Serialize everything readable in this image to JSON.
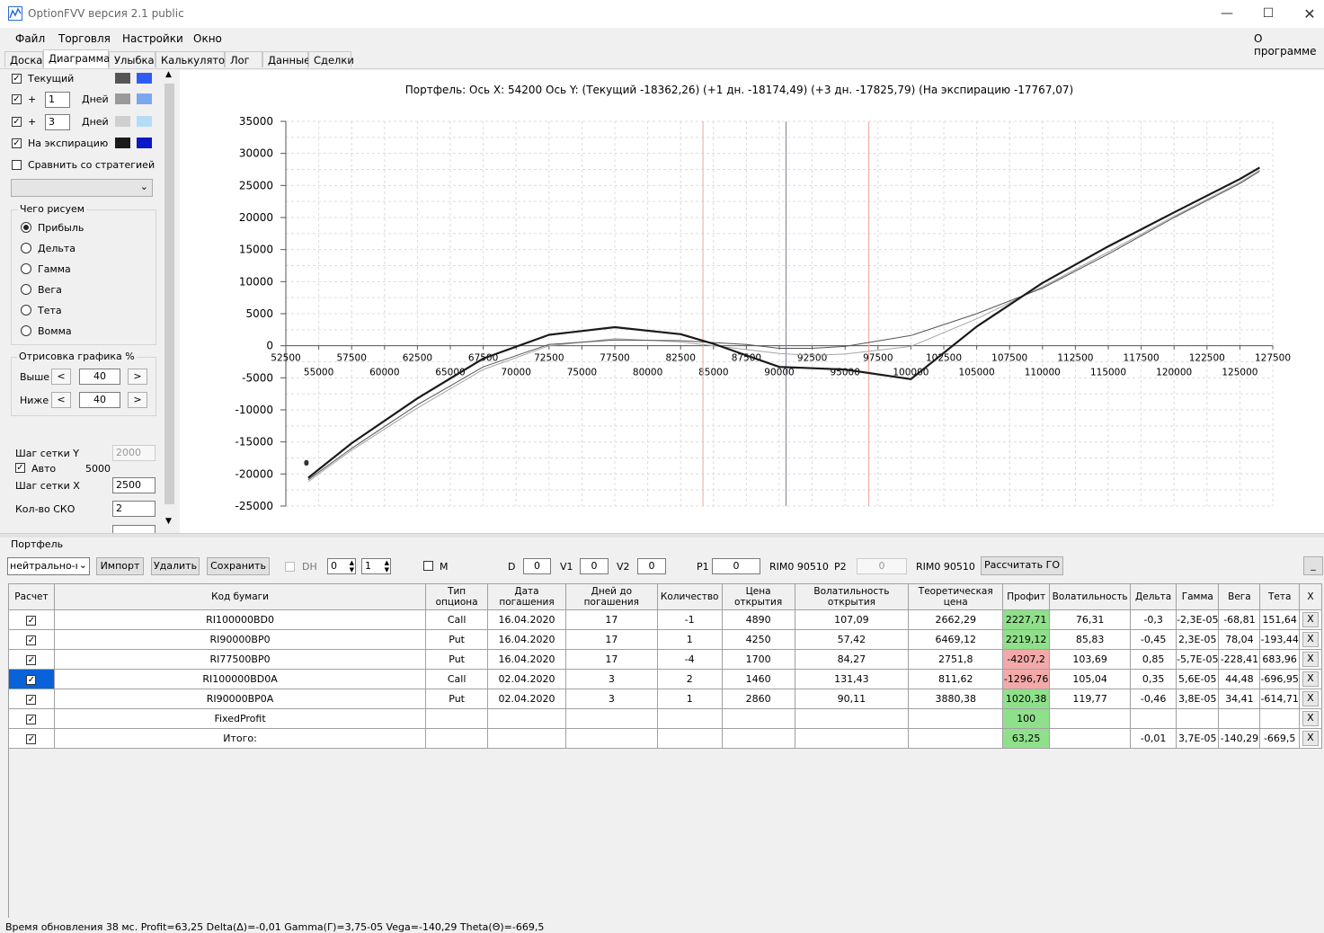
{
  "window": {
    "title": "OptionFVV версия 2.1 public"
  },
  "menu": {
    "items": [
      "Файл",
      "Торговля",
      "Настройки",
      "Окно"
    ],
    "about": "О программе"
  },
  "tabs": [
    "Доска",
    "Диаграмма",
    "Улыбка",
    "Калькулятор",
    "Лог",
    "Данные",
    "Сделки"
  ],
  "left": {
    "current_label": "Текущий",
    "plus": "+",
    "days_label": "Дней",
    "days1": "1",
    "days2": "3",
    "expiry_label": "На экспирацию",
    "compare_label": "Сравнить со стратегией",
    "what_title": "Чего рисуем",
    "radios": [
      "Прибыль",
      "Дельта",
      "Гамма",
      "Вега",
      "Тета",
      "Вомма"
    ],
    "draw_title": "Отрисовка графика %",
    "above_label": "Выше",
    "below_label": "Ниже",
    "above_val": "40",
    "below_val": "40",
    "lt": "<",
    "gt": ">",
    "gridy_label": "Шаг сетки Y",
    "gridy_val": "2000",
    "auto_label": "Авто",
    "auto_val": "5000",
    "gridx_label": "Шаг сетки X",
    "gridx_val": "2500",
    "sko_label": "Кол-во СКО",
    "sko_val": "2",
    "colors": {
      "current": [
        "#555555",
        "#2e5cf5"
      ],
      "d1": [
        "#9a9a9a",
        "#7aa7f0"
      ],
      "d3": [
        "#cfcfcf",
        "#b5dcf7"
      ],
      "expiry": [
        "#1a1a1a",
        "#0a18c8"
      ]
    }
  },
  "chart_data": {
    "type": "line",
    "title": "Портфель: Ось X: 54200 Ось Y: (Текущий -18362,26) (+1 дн. -18174,49) (+3 дн. -17825,79) (На экспирацию -17767,07)",
    "xlim": [
      52500,
      127500
    ],
    "ylim": [
      -25000,
      35000
    ],
    "x_ticks_top": [
      52500,
      57500,
      62500,
      67500,
      72500,
      77500,
      82500,
      87500,
      92500,
      97500,
      102500,
      107500,
      112500,
      117500,
      122500,
      127500
    ],
    "x_ticks_bottom": [
      55000,
      60000,
      65000,
      70000,
      75000,
      80000,
      85000,
      90000,
      95000,
      100000,
      105000,
      110000,
      115000,
      120000,
      125000
    ],
    "y_ticks": [
      35000,
      30000,
      25000,
      20000,
      15000,
      10000,
      5000,
      0,
      -5000,
      -10000,
      -15000,
      -20000,
      -25000
    ],
    "vlines": [
      {
        "x": 84200,
        "color": "#f2a6a6"
      },
      {
        "x": 90510,
        "color": "#7a7d99"
      },
      {
        "x": 96800,
        "color": "#f2a6a6"
      }
    ],
    "series": [
      {
        "color": "#1a1a1a",
        "width": 2.2,
        "x": [
          54200,
          57500,
          62500,
          67500,
          72500,
          77500,
          82500,
          85000,
          87500,
          90000,
          95000,
          100000,
          105000,
          110000,
          115000,
          120000,
          125000,
          126500
        ],
        "y": [
          -20600,
          -15200,
          -8200,
          -2000,
          1700,
          2900,
          1800,
          300,
          -1500,
          -3300,
          -3700,
          -5200,
          3000,
          9800,
          15500,
          20800,
          26000,
          27800
        ]
      },
      {
        "color": "#555555",
        "width": 1,
        "x": [
          54200,
          57500,
          62500,
          67500,
          72500,
          77500,
          82500,
          87500,
          90000,
          92500,
          95000,
          100000,
          105000,
          110000,
          115000,
          120000,
          125000,
          126500
        ],
        "y": [
          -20900,
          -16000,
          -9200,
          -3300,
          200,
          900,
          800,
          200,
          -400,
          -400,
          -100,
          1600,
          5000,
          9000,
          14300,
          20000,
          25300,
          27200
        ]
      },
      {
        "color": "#a6a6a6",
        "width": 1,
        "x": [
          54200,
          57500,
          62500,
          67500,
          72500,
          77500,
          82500,
          87500,
          90000,
          92500,
          95000,
          100000,
          105000,
          110000,
          115000,
          120000,
          125000,
          126500
        ],
        "y": [
          -21200,
          -16300,
          -9700,
          -3700,
          0,
          1100,
          600,
          -600,
          -1200,
          -1500,
          -1300,
          -100,
          4200,
          9200,
          14600,
          20200,
          25500,
          27400
        ]
      }
    ],
    "markers": [
      {
        "x": 54200,
        "y": -18362
      },
      {
        "x": 54200,
        "y": -18174
      }
    ]
  },
  "portfolio": {
    "title": "Портфель",
    "strategy_select": "нейтрально-н",
    "import_btn": "Импорт",
    "delete_btn": "Удалить",
    "save_btn": "Сохранить",
    "dh_label": "DH",
    "spin1": "0",
    "spin2": "1",
    "m_label": "M",
    "d_label": "D",
    "d_val": "0",
    "v1_label": "V1",
    "v1_val": "0",
    "v2_label": "V2",
    "v2_val": "0",
    "p1_label": "P1",
    "p1_val": "0",
    "rim1": "RIM0 90510",
    "p2_label": "P2",
    "p2_val": "0",
    "rim2": "RIM0 90510",
    "calc_btn": "Рассчитать ГО",
    "min_btn": "_"
  },
  "table": {
    "headers": [
      "Расчет",
      "Код бумаги",
      "Тип опциона",
      "Дата погашения",
      "Дней до погашения",
      "Количество",
      "Цена открытия",
      "Волатильность открытия",
      "Теоретическая цена",
      "Профит",
      "Волатильность",
      "Дельта",
      "Гамма",
      "Вега",
      "Тета",
      "X"
    ],
    "rows": [
      [
        "RI100000BD0",
        "Call",
        "16.04.2020",
        "17",
        "-1",
        "4890",
        "107,09",
        "2662,29",
        "2227,71",
        "76,31",
        "-0,3",
        "-2,3E-05",
        "-68,81",
        "151,64"
      ],
      [
        "RI90000BP0",
        "Put",
        "16.04.2020",
        "17",
        "1",
        "4250",
        "57,42",
        "6469,12",
        "2219,12",
        "85,83",
        "-0,45",
        "2,3E-05",
        "78,04",
        "-193,44"
      ],
      [
        "RI77500BP0",
        "Put",
        "16.04.2020",
        "17",
        "-4",
        "1700",
        "84,27",
        "2751,8",
        "-4207,2",
        "103,69",
        "0,85",
        "-5,7E-05",
        "-228,41",
        "683,96"
      ],
      [
        "RI100000BD0A",
        "Call",
        "02.04.2020",
        "3",
        "2",
        "1460",
        "131,43",
        "811,62",
        "-1296,76",
        "105,04",
        "0,35",
        "5,6E-05",
        "44,48",
        "-696,95"
      ],
      [
        "RI90000BP0A",
        "Put",
        "02.04.2020",
        "3",
        "1",
        "2860",
        "90,11",
        "3880,38",
        "1020,38",
        "119,77",
        "-0,46",
        "3,8E-05",
        "34,41",
        "-614,71"
      ],
      [
        "FixedProfit",
        "",
        "",
        "",
        "",
        "",
        "",
        "",
        "100",
        "",
        "",
        "",
        "",
        ""
      ],
      [
        "Итого:",
        "",
        "",
        "",
        "",
        "",
        "",
        "",
        "63,25",
        "",
        "-0,01",
        "3,7E-05",
        "-140,29",
        "-669,5"
      ]
    ],
    "profit_class": [
      "pos",
      "pos",
      "neg",
      "neg",
      "pos",
      "pos",
      "pos"
    ],
    "x_label": "X",
    "check_mark": "✓"
  },
  "status": {
    "text": "Время обновления 38 мс. Profit=63,25 Delta(Δ)=-0,01 Gamma(Γ)=3,75-05 Vega=-140,29 Theta(Θ)=-669,5"
  }
}
